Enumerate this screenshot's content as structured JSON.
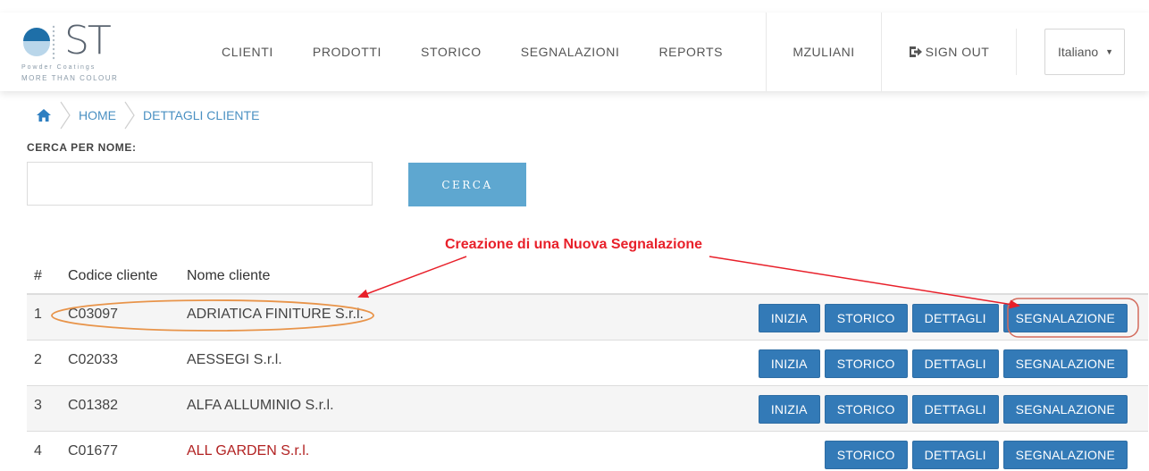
{
  "logo": {
    "text": "ST",
    "tagline1": "Powder Coatings",
    "tagline2": "MORE THAN COLOUR"
  },
  "nav": {
    "items": [
      "CLIENTI",
      "PRODOTTI",
      "STORICO",
      "SEGNALAZIONI",
      "REPORTS"
    ],
    "user": "MZULIANI",
    "signout": "SIGN OUT",
    "language": "Italiano"
  },
  "breadcrumb": {
    "home": "HOME",
    "current": "DETTAGLI CLIENTE"
  },
  "search": {
    "label": "CERCA PER NOME:",
    "value": "",
    "button": "CERCA"
  },
  "annotation": "Creazione di una Nuova Segnalazione",
  "table": {
    "headers": [
      "#",
      "Codice cliente",
      "Nome cliente"
    ],
    "rows": [
      {
        "num": "1",
        "code": "C03097",
        "name": "ADRIATICA FINITURE S.r.l.",
        "buttons": [
          "INIZIA",
          "STORICO",
          "DETTAGLI",
          "SEGNALAZIONE"
        ]
      },
      {
        "num": "2",
        "code": "C02033",
        "name": "AESSEGI S.r.l.",
        "buttons": [
          "INIZIA",
          "STORICO",
          "DETTAGLI",
          "SEGNALAZIONE"
        ]
      },
      {
        "num": "3",
        "code": "C01382",
        "name": "ALFA ALLUMINIO S.r.l.",
        "buttons": [
          "INIZIA",
          "STORICO",
          "DETTAGLI",
          "SEGNALAZIONE"
        ]
      },
      {
        "num": "4",
        "code": "C01677",
        "name": "ALL GARDEN S.r.l.",
        "buttons": [
          "STORICO",
          "DETTAGLI",
          "SEGNALAZIONE"
        ]
      }
    ]
  },
  "colors": {
    "primary_button": "#337ab7",
    "search_button": "#5ea7d0",
    "link": "#4a90c2",
    "annotation": "#e8202a",
    "highlight_oval": "#e8944a"
  }
}
